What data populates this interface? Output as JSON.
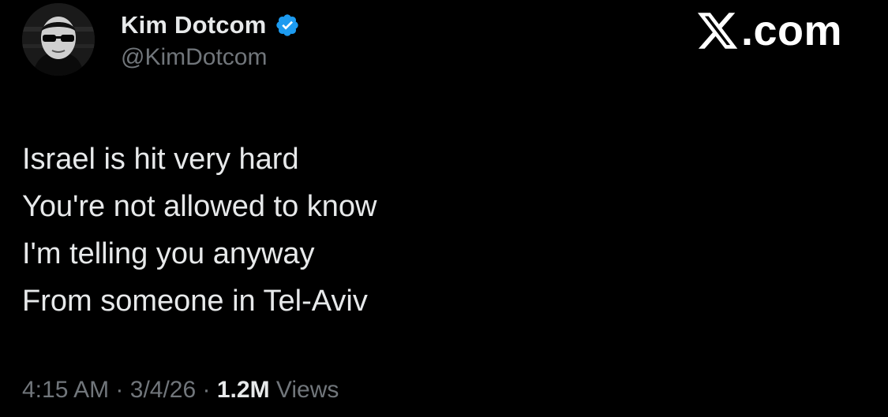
{
  "author": {
    "display_name": "Kim Dotcom",
    "handle": "@KimDotcom",
    "verified": true,
    "verified_color": "#1d9bf0",
    "avatar_icon": "profile-photo"
  },
  "brand": {
    "logo_icon": "x-logo-icon",
    "suffix": ".com"
  },
  "tweet": {
    "lines": [
      "Israel is hit very hard",
      "You're not allowed to know",
      "I'm telling you anyway",
      "From someone in Tel-Aviv"
    ]
  },
  "meta": {
    "time": "4:15 AM",
    "separator": "·",
    "date": "3/4/26",
    "views_count": "1.2M",
    "views_label": "Views"
  },
  "colors": {
    "background": "#000000",
    "primary_text": "#e7e9ea",
    "secondary_text": "#71767b"
  }
}
